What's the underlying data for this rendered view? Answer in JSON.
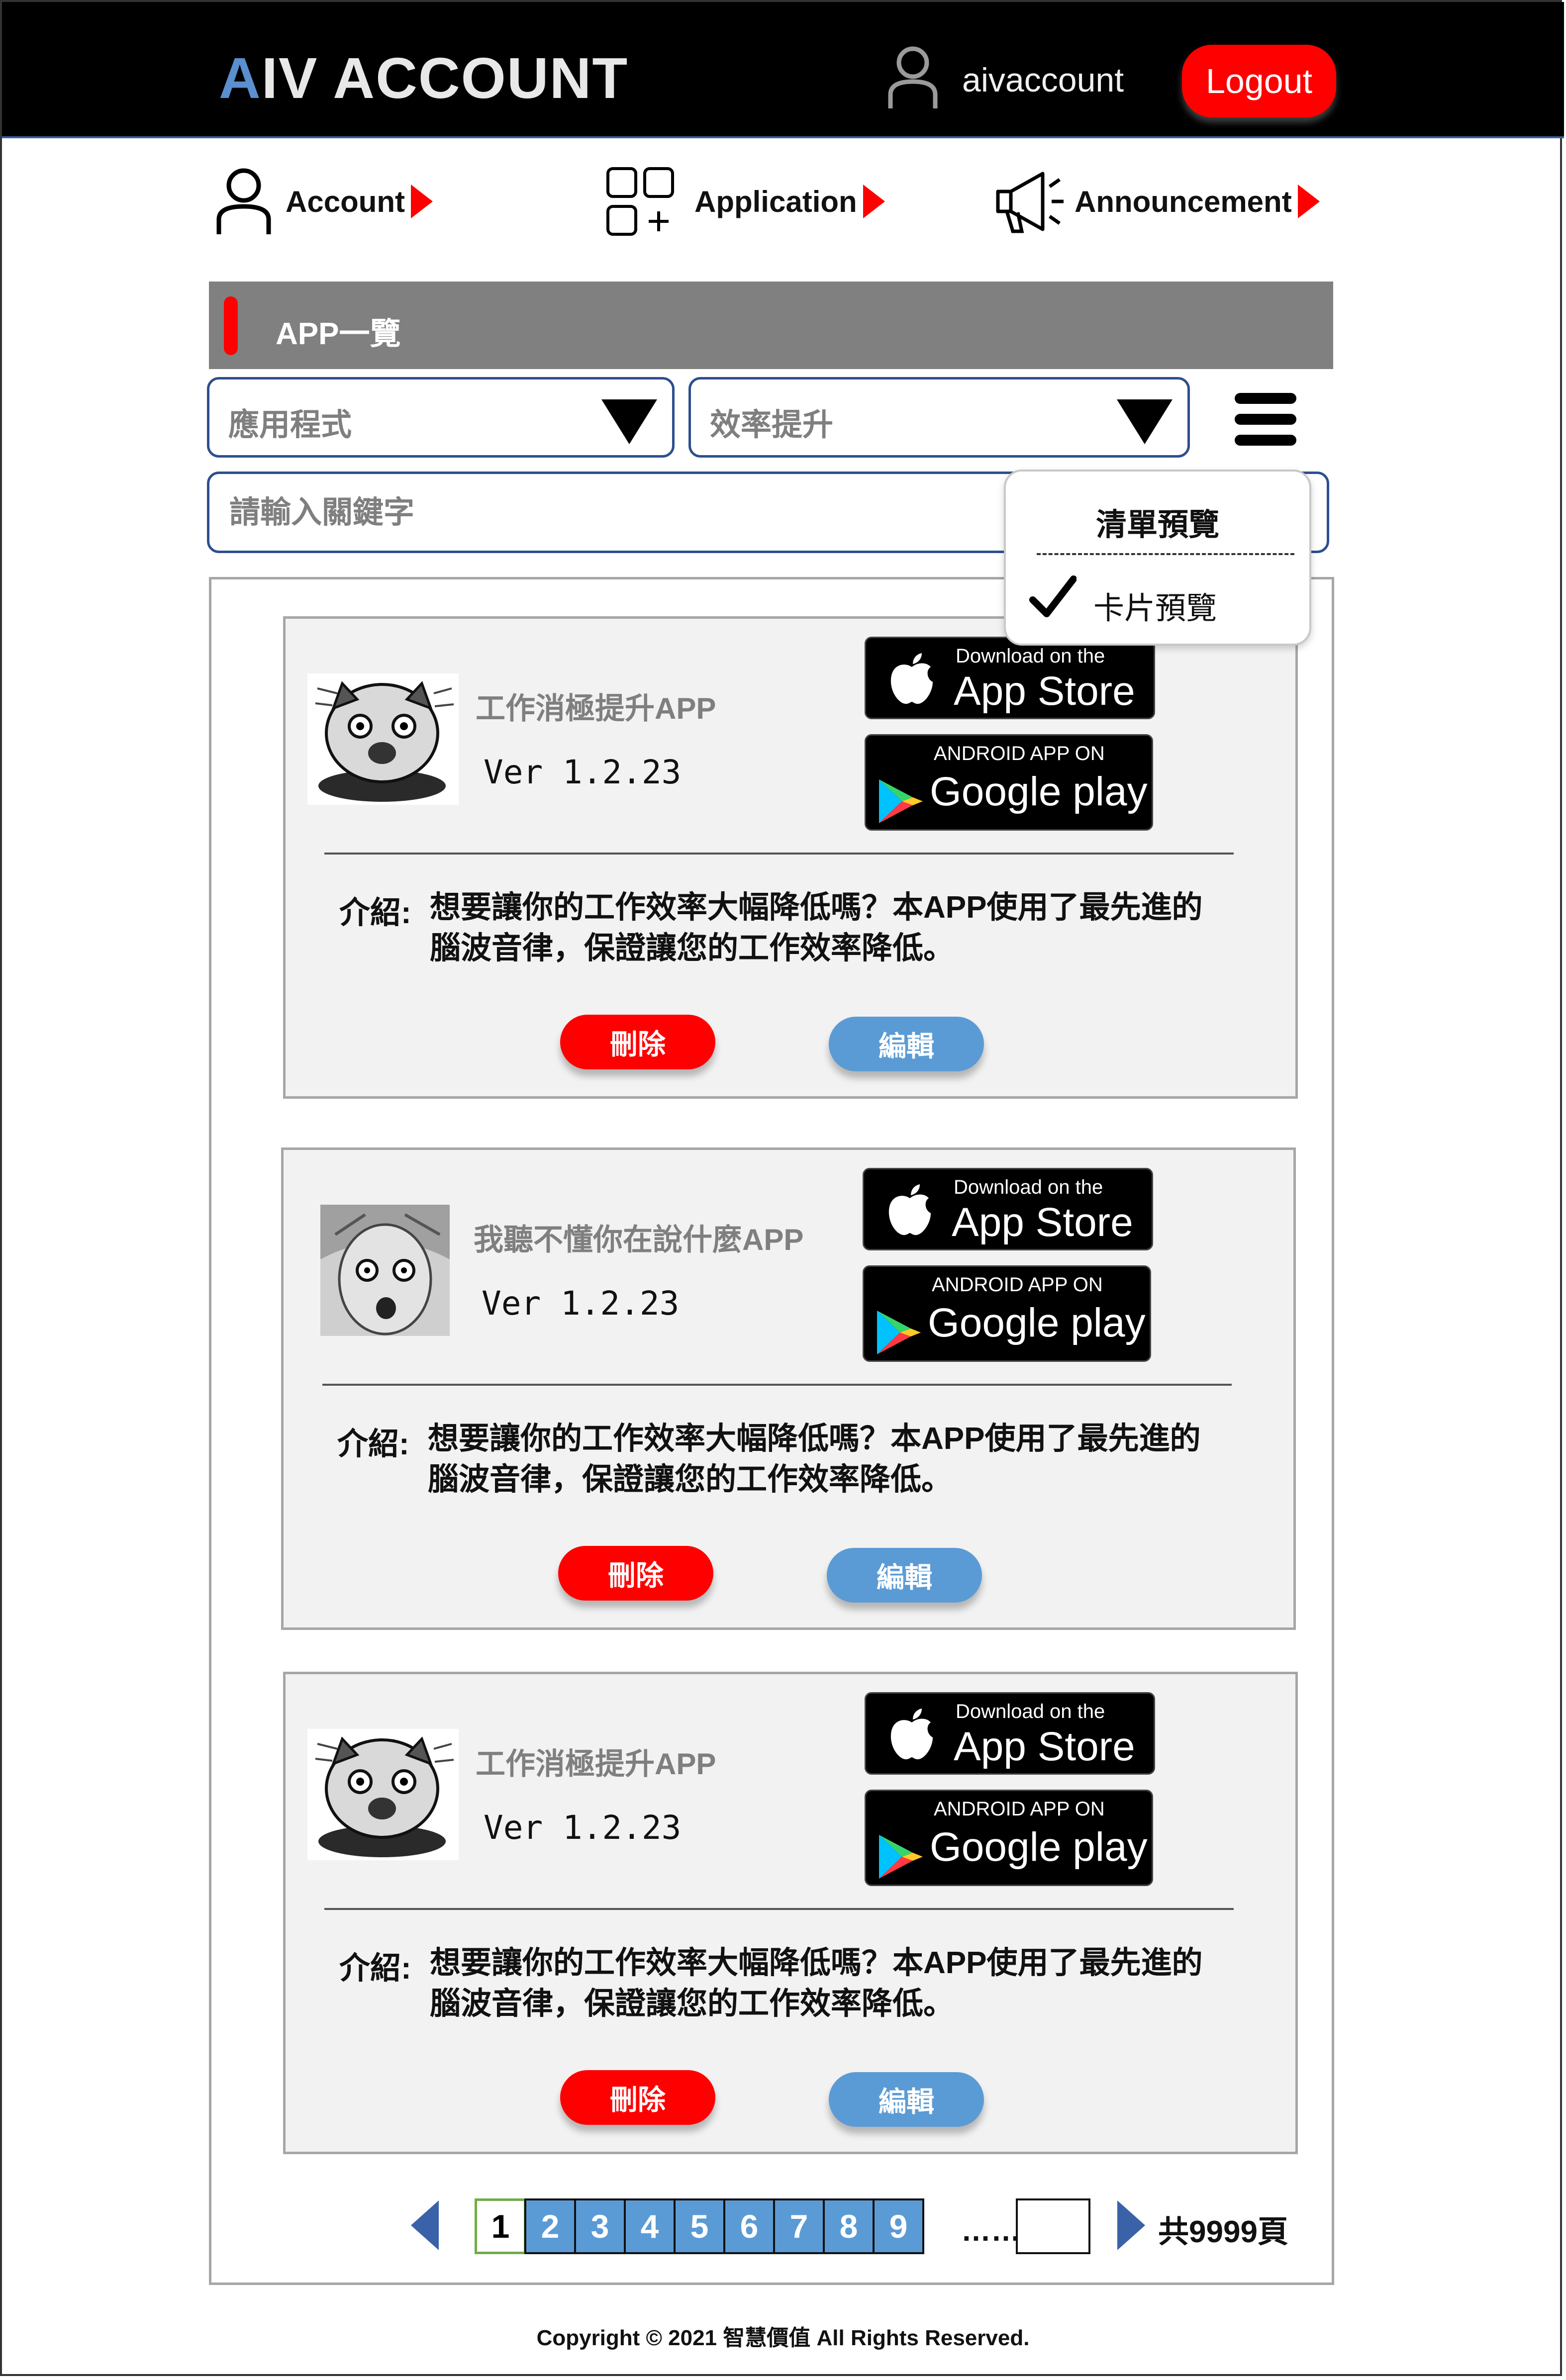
{
  "header": {
    "logo_first": "A",
    "logo_rest": "IV ACCOUNT",
    "username": "aivaccount",
    "logout_label": "Logout"
  },
  "nav": {
    "account": "Account",
    "application": "Application",
    "announcement": "Announcement"
  },
  "section": {
    "title": "APP一覽"
  },
  "filters": {
    "category": "應用程式",
    "subcategory": "效率提升",
    "search_placeholder": "請輸入關鍵字"
  },
  "view_menu": {
    "list_view": "清單預覽",
    "card_view": "卡片預覽",
    "selected": "card_view"
  },
  "store_badges": {
    "apple_small": "Download on the",
    "apple_big": "App Store",
    "google_small": "ANDROID APP ON",
    "google_big": "Google play"
  },
  "apps": [
    {
      "name": "工作消極提升APP",
      "version": "Ver 1.2.23",
      "desc_label": "介紹:",
      "desc": "想要讓你的工作效率大幅降低嗎？本APP使用了最先進的腦波音律，保證讓您的工作效率降低。",
      "delete_label": "刪除",
      "edit_label": "編輯"
    },
    {
      "name": "我聽不懂你在說什麼APP",
      "version": "Ver 1.2.23",
      "desc_label": "介紹:",
      "desc": "想要讓你的工作效率大幅降低嗎？本APP使用了最先進的腦波音律，保證讓您的工作效率降低。",
      "delete_label": "刪除",
      "edit_label": "編輯"
    },
    {
      "name": "工作消極提升APP",
      "version": "Ver 1.2.23",
      "desc_label": "介紹:",
      "desc": "想要讓你的工作效率大幅降低嗎？本APP使用了最先進的腦波音律，保證讓您的工作效率降低。",
      "delete_label": "刪除",
      "edit_label": "編輯"
    }
  ],
  "pagination": {
    "pages": [
      "1",
      "2",
      "3",
      "4",
      "5",
      "6",
      "7",
      "8",
      "9"
    ],
    "current": "1",
    "ellipsis": "……",
    "total": "共9999頁"
  },
  "footer": {
    "copyright": "Copyright © 2021 智慧價值 All Rights Reserved."
  },
  "colors": {
    "header_bg": "#000000",
    "accent_red": "#ff0000",
    "edit_blue": "#5b9bd5",
    "section_gray": "#808080",
    "card_bg": "#f2f2f2",
    "border_blue": "#2e4f8f"
  },
  "icons": [
    "user-icon",
    "grid-plus-icon",
    "megaphone-icon",
    "hamburger-menu-icon",
    "check-icon",
    "apple-logo-icon",
    "google-play-icon",
    "chevron-left-icon",
    "chevron-right-icon"
  ]
}
